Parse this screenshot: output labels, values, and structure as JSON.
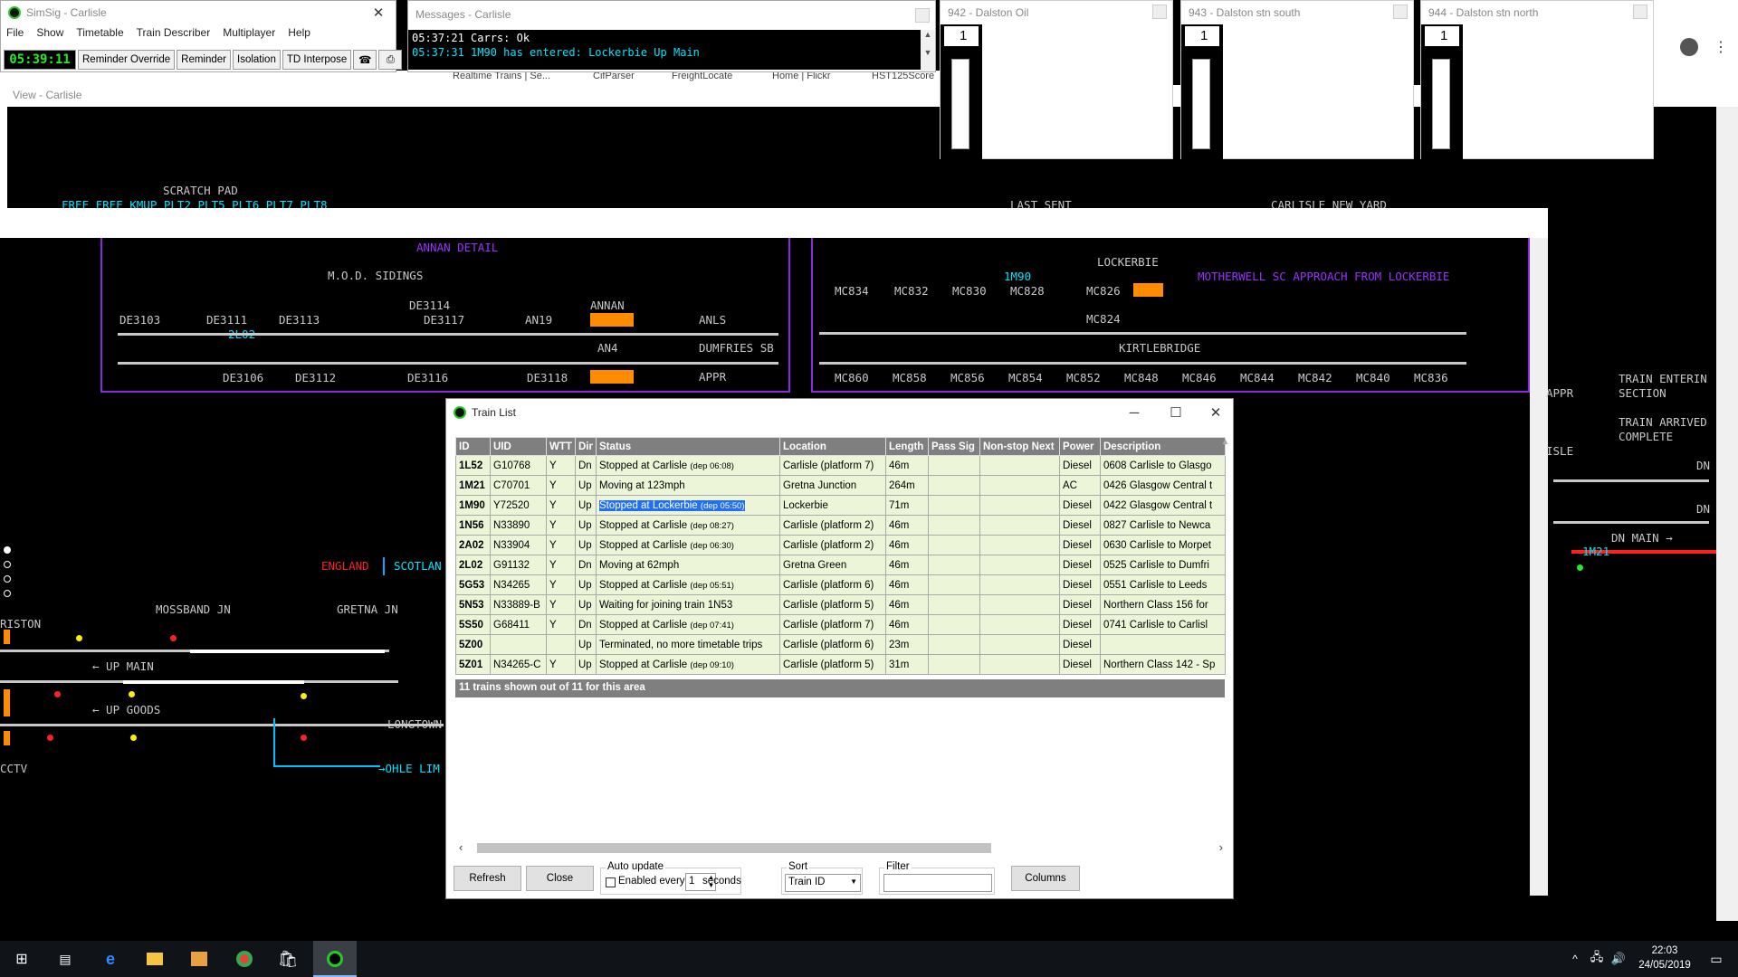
{
  "simsig": {
    "title": "SimSig - Carlisle",
    "menu": [
      "File",
      "Show",
      "Timetable",
      "Train Describer",
      "Multiplayer",
      "Help"
    ],
    "clock": "05:39:11",
    "buttons": [
      "Reminder Override",
      "Reminder",
      "Isolation",
      "TD Interpose"
    ]
  },
  "messages": {
    "title": "Messages - Carlisle",
    "lines": [
      "05:37:21 Carrs: Ok",
      "05:37:31 1M90 has entered: Lockerbie Up Main"
    ]
  },
  "berths": [
    {
      "title": "942 - Dalston Oil",
      "value": "1"
    },
    {
      "title": "943 - Dalston stn south",
      "value": "1"
    },
    {
      "title": "944 - Dalston stn north",
      "value": "1"
    }
  ],
  "browser_bookmarks": [
    "Realtime Trains | Se...",
    "CifParser",
    "FreightLocate",
    "Home | Flickr",
    "HST125Score"
  ],
  "view": {
    "title": "View - Carlisle"
  },
  "diagram": {
    "scratch_pad": "SCRATCH PAD",
    "scratch_items": "FREE FREE KMUP PLT2 PLT5 PLT6 PLT7 PLT8",
    "last_sent": "LAST SENT",
    "carlisle_new_yard": "CARLISLE NEW YARD",
    "annan_detail": "ANNAN DETAIL",
    "mod_sidings": "M.O.D. SIDINGS",
    "annan": "ANNAN",
    "anls": "ANLS",
    "dumfries_sb": "DUMFRIES SB",
    "appr": "APPR",
    "an4": "AN4",
    "an19": "AN19",
    "de_top": [
      "DE3103",
      "DE3111",
      "DE3113",
      "DE3114",
      "DE3117"
    ],
    "de_bottom": [
      "DE3106",
      "DE3112",
      "DE3116",
      "DE3118"
    ],
    "train_2l02": "2L02",
    "lockerbie": "LOCKERBIE",
    "motherwell": "MOTHERWELL SC APPROACH FROM LOCKERBIE",
    "kirtlebridge": "KIRTLEBRIDGE",
    "train_1m90": "1M90",
    "mc_top": [
      "MC834",
      "MC832",
      "MC830",
      "MC828",
      "MC826"
    ],
    "mc824": "MC824",
    "mc_bottom": [
      "MC860",
      "MC858",
      "MC856",
      "MC854",
      "MC852",
      "MC848",
      "MC846",
      "MC844",
      "MC842",
      "MC840",
      "MC836"
    ],
    "england": "ENGLAND",
    "scotland": "SCOTLAN",
    "mossband": "MOSSBAND JN",
    "gretna": "GRETNA JN",
    "riston": "RISTON",
    "up_main": "← UP MAIN",
    "up_goods": "← UP GOODS",
    "longtown": "LONGTOWN",
    "ohle": "→OHLE LIM",
    "cctv": "CCTV",
    "appr_right": "APPR",
    "isle": "ISLE",
    "train_entering": "TRAIN ENTERIN",
    "section": "SECTION",
    "train_arrived": "TRAIN ARRIVED",
    "complete": "COMPLETE",
    "dn": "DN",
    "dn_main": "DN MAIN →",
    "train_1m21": "1M21"
  },
  "trainlist": {
    "title": "Train List",
    "columns": [
      "ID",
      "UID",
      "WTT",
      "Dir",
      "Status",
      "Location",
      "Length",
      "Pass Sig",
      "Non-stop Next",
      "Power",
      "Description"
    ],
    "rows": [
      {
        "id": "1L52",
        "uid": "G10768",
        "wtt": "Y",
        "dir": "Dn",
        "status": "Stopped at Carlisle",
        "dep": "(dep 06:08)",
        "loc": "Carlisle (platform 7)",
        "len": "46m",
        "pass": "",
        "nsn": "",
        "power": "Diesel",
        "desc": "0608 Carlisle to Glasgo"
      },
      {
        "id": "1M21",
        "uid": "C70701",
        "wtt": "Y",
        "dir": "Up",
        "status": "Moving at 123mph",
        "dep": "",
        "loc": "Gretna Junction",
        "len": "264m",
        "pass": "",
        "nsn": "",
        "power": "AC",
        "desc": "0426 Glasgow Central t"
      },
      {
        "id": "1M90",
        "uid": "Y72520",
        "wtt": "Y",
        "dir": "Up",
        "status": "Stopped at Lockerbie",
        "dep": "(dep 05:50)",
        "loc": "Lockerbie",
        "len": "71m",
        "pass": "",
        "nsn": "",
        "power": "Diesel",
        "desc": "0422 Glasgow Central t"
      },
      {
        "id": "1N56",
        "uid": "N33890",
        "wtt": "Y",
        "dir": "Up",
        "status": "Stopped at Carlisle",
        "dep": "(dep 08:27)",
        "loc": "Carlisle (platform 2)",
        "len": "46m",
        "pass": "",
        "nsn": "",
        "power": "Diesel",
        "desc": "0827 Carlisle to Newca"
      },
      {
        "id": "2A02",
        "uid": "N33904",
        "wtt": "Y",
        "dir": "Up",
        "status": "Stopped at Carlisle",
        "dep": "(dep 06:30)",
        "loc": "Carlisle (platform 2)",
        "len": "46m",
        "pass": "",
        "nsn": "",
        "power": "Diesel",
        "desc": "0630 Carlisle to Morpet"
      },
      {
        "id": "2L02",
        "uid": "G91132",
        "wtt": "Y",
        "dir": "Dn",
        "status": "Moving at 62mph",
        "dep": "",
        "loc": "Gretna Green",
        "len": "46m",
        "pass": "",
        "nsn": "",
        "power": "Diesel",
        "desc": "0525 Carlisle to Dumfri"
      },
      {
        "id": "5G53",
        "uid": "N34265",
        "wtt": "Y",
        "dir": "Up",
        "status": "Stopped at Carlisle",
        "dep": "(dep 05:51)",
        "loc": "Carlisle (platform 6)",
        "len": "46m",
        "pass": "",
        "nsn": "",
        "power": "Diesel",
        "desc": "0551 Carlisle to Leeds"
      },
      {
        "id": "5N53",
        "uid": "N33889-B",
        "wtt": "Y",
        "dir": "Up",
        "status": "Waiting for joining train 1N53",
        "dep": "",
        "loc": "Carlisle (platform 5)",
        "len": "46m",
        "pass": "",
        "nsn": "",
        "power": "Diesel",
        "desc": "Northern Class 156 for"
      },
      {
        "id": "5S50",
        "uid": "G68411",
        "wtt": "Y",
        "dir": "Dn",
        "status": "Stopped at Carlisle",
        "dep": "(dep 07:41)",
        "loc": "Carlisle (platform 7)",
        "len": "46m",
        "pass": "",
        "nsn": "",
        "power": "Diesel",
        "desc": "0741 Carlisle to Carlisl"
      },
      {
        "id": "5Z00",
        "uid": "",
        "wtt": "",
        "dir": "Up",
        "status": "Terminated, no more timetable trips",
        "dep": "",
        "loc": "Carlisle (platform 6)",
        "len": "23m",
        "pass": "",
        "nsn": "",
        "power": "Diesel",
        "desc": ""
      },
      {
        "id": "5Z01",
        "uid": "N34265-C",
        "wtt": "Y",
        "dir": "Up",
        "status": "Stopped at Carlisle",
        "dep": "(dep 09:10)",
        "loc": "Carlisle (platform 5)",
        "len": "31m",
        "pass": "",
        "nsn": "",
        "power": "Diesel",
        "desc": "Northern Class 142 - Sp"
      }
    ],
    "summary": "11 trains shown out of 11 for this area",
    "refresh": "Refresh",
    "close": "Close",
    "auto_update": "Auto update",
    "enabled_every": "Enabled every",
    "interval": "1",
    "seconds": "seconds",
    "sort": "Sort",
    "sort_value": "Train ID",
    "filter": "Filter",
    "filter_value": "",
    "columns_btn": "Columns"
  },
  "taskbar": {
    "time": "22:03",
    "date": "24/05/2019"
  }
}
